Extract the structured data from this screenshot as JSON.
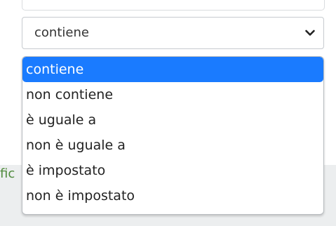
{
  "select": {
    "value": "contiene"
  },
  "dropdown": {
    "options": [
      "contiene",
      "non contiene",
      "è uguale a",
      "non è uguale a",
      "è impostato",
      "non è impostato"
    ],
    "selected_index": 0
  },
  "background": {
    "peek_text": "fic"
  },
  "colors": {
    "highlight": "#1a7bff",
    "peek_text": "#4f8a3c"
  }
}
